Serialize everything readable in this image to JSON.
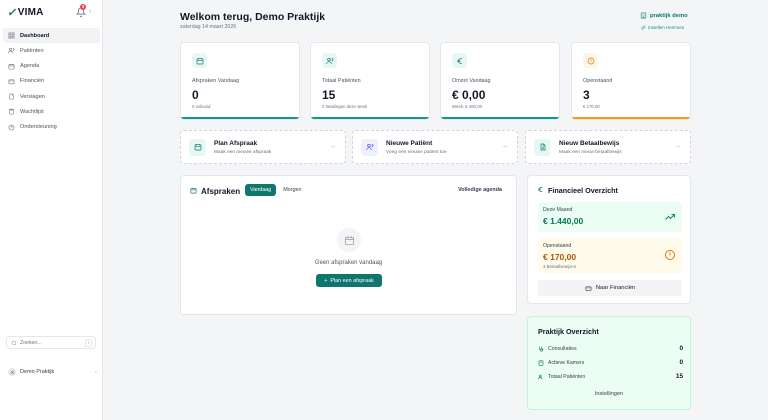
{
  "brand": {
    "name": "VIMA",
    "notification_count": "3"
  },
  "sidebar": {
    "items": [
      {
        "label": "Dashboard",
        "icon": "grid-icon",
        "active": true
      },
      {
        "label": "Patiënten",
        "icon": "users-icon"
      },
      {
        "label": "Agenda",
        "icon": "calendar-icon"
      },
      {
        "label": "Financiën",
        "icon": "wallet-icon"
      },
      {
        "label": "Verslagen",
        "icon": "file-icon"
      },
      {
        "label": "Wachtlijst",
        "icon": "clipboard-icon"
      },
      {
        "label": "Ondersteuning",
        "icon": "help-icon"
      }
    ],
    "search": {
      "placeholder": "Zoeken...",
      "shortcut": "/"
    },
    "user": {
      "name": "Demo Praktijk"
    }
  },
  "header": {
    "title": "Welkom terug, Demo Praktijk",
    "date": "zaterdag 14 maart 2026",
    "practice_link": "praktijk demo",
    "settings_link": "Instellen Herinnen"
  },
  "stats": [
    {
      "label": "Afspraken Vandaag",
      "value": "0",
      "sub": "0 voltooid",
      "accent": "#0f9a8e",
      "icon_bg": "#e6f7f4",
      "icon_color": "#0f766e",
      "icon": "calendar-icon"
    },
    {
      "label": "Totaal Patiënten",
      "value": "15",
      "sub": "0 betalingen deze week",
      "accent": "#0f9a8e",
      "icon_bg": "#e6f7f4",
      "icon_color": "#0f766e",
      "icon": "users-icon"
    },
    {
      "label": "Omzet Vandaag",
      "value": "€ 0,00",
      "sub": "Week: € 360,00",
      "accent": "#0f9a8e",
      "icon_bg": "#e6f7f4",
      "icon_color": "#0f766e",
      "icon": "euro-icon"
    },
    {
      "label": "Openstaand",
      "value": "3",
      "sub": "€ 170,00",
      "accent": "#f59e0b",
      "icon_bg": "#fef6e4",
      "icon_color": "#d97706",
      "icon": "alert-circle-icon"
    }
  ],
  "actions": [
    {
      "title": "Plan Afspraak",
      "sub": "Maak een nieuwe afspraak",
      "icon_bg": "#e6f7f4",
      "icon_color": "#0f766e"
    },
    {
      "title": "Nieuwe Patiënt",
      "sub": "Voeg een nieuwe patiënt toe",
      "icon_bg": "#eef0fb",
      "icon_color": "#4f46e5"
    },
    {
      "title": "Nieuw Betaalbewijs",
      "sub": "Maak een nieuw betaalbewijs",
      "icon_bg": "#e6f7f4",
      "icon_color": "#0f766e"
    }
  ],
  "appointments": {
    "title": "Afspraken",
    "tabs": [
      "Vandaag",
      "Morgen"
    ],
    "full_agenda": "Volledige agenda",
    "empty_text": "Geen afspraken vandaag",
    "plan_button": "Plan een afspraak"
  },
  "finance": {
    "title": "Financieel Overzicht",
    "month_label": "Deze Maand",
    "month_value": "€ 1.440,00",
    "open_label": "Openstaand",
    "open_value": "€ 170,00",
    "open_sub": "3 Betaalbewijzen",
    "button": "Naar Financiën",
    "month_color": "#047857",
    "open_color": "#b45309"
  },
  "practice": {
    "title": "Praktijk Overzicht",
    "rows": [
      {
        "label": "Consultaties",
        "value": "0"
      },
      {
        "label": "Actieve Kamers",
        "value": "0"
      },
      {
        "label": "Totaal Patiënten",
        "value": "15"
      }
    ],
    "settings": "Instellingen"
  }
}
